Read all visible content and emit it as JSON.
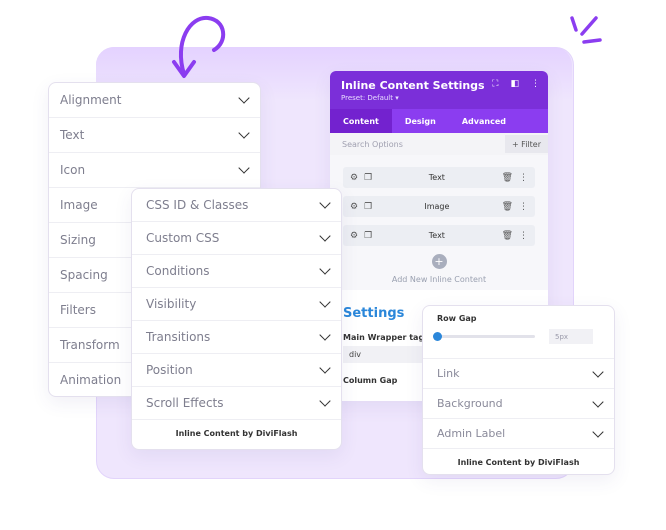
{
  "left_panel": {
    "items": [
      "Alignment",
      "Text",
      "Icon",
      "Image",
      "Sizing",
      "Spacing",
      "Filters",
      "Transform",
      "Animation"
    ]
  },
  "middle_panel": {
    "items": [
      "CSS ID & Classes",
      "Custom CSS",
      "Conditions",
      "Visibility",
      "Transitions",
      "Position",
      "Scroll Effects"
    ],
    "footer": "Inline Content by DiviFlash"
  },
  "settings_panel": {
    "title": "Inline Content Settings",
    "preset": "Preset: Default ▾",
    "tabs": [
      "Content",
      "Design",
      "Advanced"
    ],
    "active_tab": "Content",
    "search_placeholder": "Search Options",
    "filter_label": "+ Filter",
    "content_items": [
      "Text",
      "Image",
      "Text"
    ],
    "add_label": "Add New Inline Content",
    "section_title": "Settings",
    "wrapper_label": "Main Wrapper tag",
    "wrapper_value": "div",
    "column_gap_label": "Column Gap"
  },
  "right_panel": {
    "row_gap_label": "Row Gap",
    "row_gap_value": "5px",
    "row_gap_level": 0.0,
    "items": [
      "Link",
      "Background",
      "Admin Label"
    ],
    "footer": "Inline Content by DiviFlash"
  },
  "colors": {
    "accent_purple": "#7b2fd9",
    "accent_blue": "#2b87da",
    "background_card": "#efe6fd"
  }
}
